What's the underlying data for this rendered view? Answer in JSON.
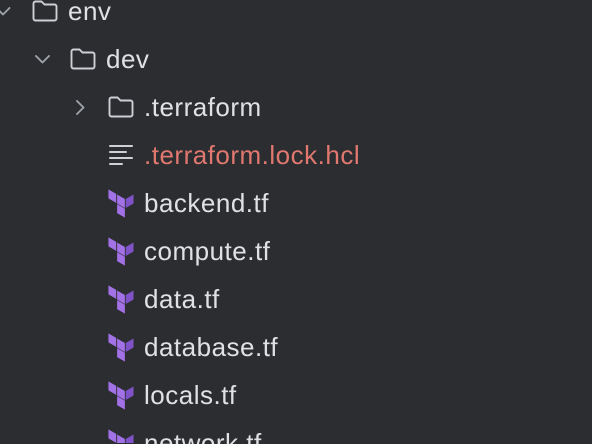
{
  "tree": {
    "label": "env",
    "expanded": true,
    "icon": "folder-icon",
    "children": [
      {
        "label": "dev",
        "expanded": true,
        "icon": "folder-icon",
        "children": [
          {
            "label": ".terraform",
            "expanded": false,
            "icon": "folder-icon"
          },
          {
            "label": ".terraform.lock.hcl",
            "icon": "text-file-icon",
            "text_color": "#e0786f"
          },
          {
            "label": "backend.tf",
            "icon": "terraform-icon"
          },
          {
            "label": "compute.tf",
            "icon": "terraform-icon"
          },
          {
            "label": "data.tf",
            "icon": "terraform-icon"
          },
          {
            "label": "database.tf",
            "icon": "terraform-icon"
          },
          {
            "label": "locals.tf",
            "icon": "terraform-icon"
          },
          {
            "label": "network.tf",
            "icon": "terraform-icon"
          }
        ]
      }
    ]
  },
  "colors": {
    "background": "#2b2d30",
    "text": "#dfe1e5",
    "chevron": "#9fa3a9",
    "folder_icon": "#ced0d6",
    "terraform_icon_light": "#a371e6",
    "terraform_icon_dark": "#7f52c8"
  }
}
